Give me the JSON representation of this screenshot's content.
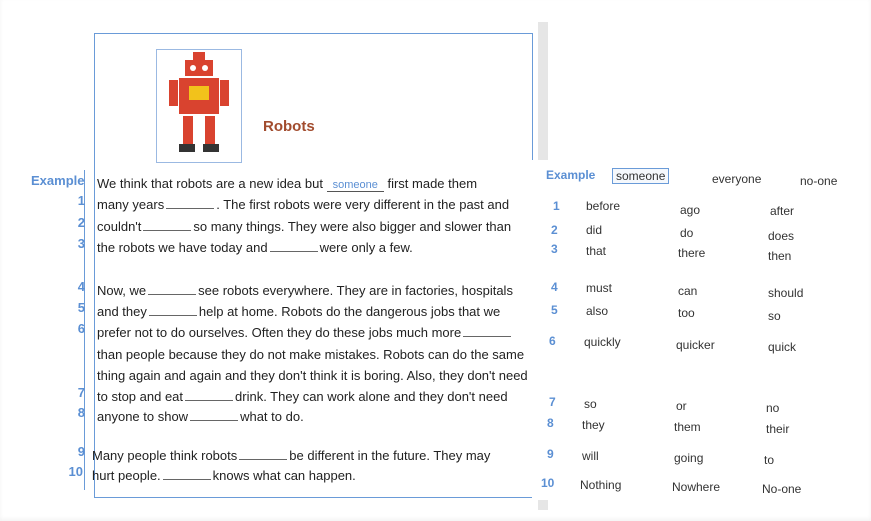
{
  "title": "Robots",
  "example_label": "Example",
  "example_answer": "someone",
  "text": {
    "ex": [
      "We think that robots are a new idea but",
      "first made them"
    ],
    "l1": [
      "many years",
      ". The first robots were very different in the past and"
    ],
    "l2": [
      "couldn't",
      "so many things. They were also bigger and slower than"
    ],
    "l3": [
      "the robots we have today and",
      "were only a few."
    ],
    "l4": [
      "Now, we",
      "see robots everywhere. They are in factories, hospitals"
    ],
    "l5": [
      "and they",
      "help at home. Robots do the dangerous jobs that we"
    ],
    "l6a": [
      "prefer not to do ourselves. Often they do these jobs much more",
      ""
    ],
    "l6b": "than people because they do not make mistakes. Robots can do the same",
    "l6c": "thing again and again and they don't think it is boring. Also, they don't need",
    "l7": [
      "to stop and eat",
      "drink. They can work alone and they don't need"
    ],
    "l8": [
      "anyone to show",
      "what to do."
    ],
    "l9": [
      "Many people think robots",
      "be different in the future. They may"
    ],
    "l10": [
      "hurt people.",
      "knows what can happen."
    ]
  },
  "numbers": [
    "1",
    "2",
    "3",
    "4",
    "5",
    "6",
    "7",
    "8",
    "9",
    "10"
  ],
  "options": {
    "example": [
      "someone",
      "everyone",
      "no-one"
    ],
    "rows": [
      [
        "before",
        "ago",
        "after"
      ],
      [
        "did",
        "do",
        "does"
      ],
      [
        "that",
        "there",
        "then"
      ],
      [
        "must",
        "can",
        "should"
      ],
      [
        "also",
        "too",
        "so"
      ],
      [
        "quickly",
        "quicker",
        "quick"
      ],
      [
        "so",
        "or",
        "no"
      ],
      [
        "they",
        "them",
        "their"
      ],
      [
        "will",
        "going",
        "to"
      ],
      [
        "Nothing",
        "Nowhere",
        "No-one"
      ]
    ]
  },
  "colors": {
    "accent": "#5b8fd3",
    "title": "#a24c2e",
    "robot": "#d9432f"
  }
}
